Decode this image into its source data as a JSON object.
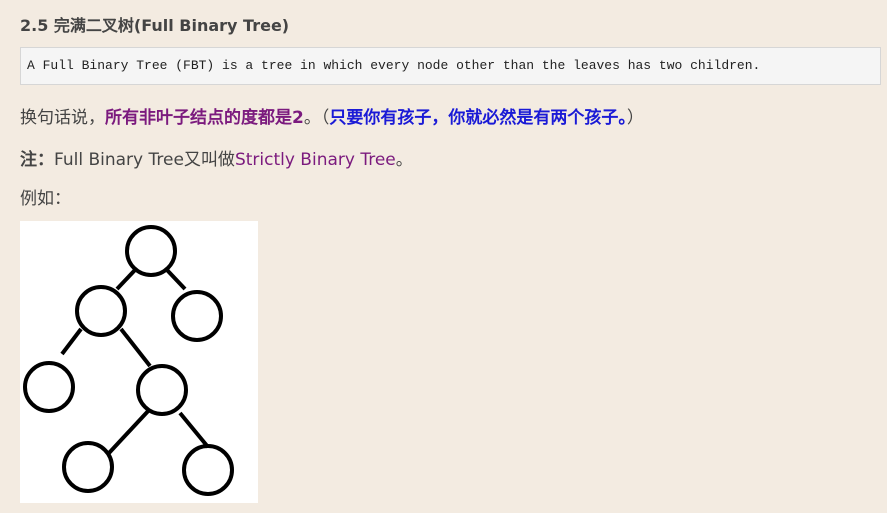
{
  "section": {
    "title": "2.5 完满二叉树(Full Binary Tree)"
  },
  "definition": {
    "code_text": "A Full Binary Tree (FBT) is a tree in which every node other than the leaves has two children."
  },
  "paragraph1": {
    "prefix": "换句话说，",
    "highlight": "所有非叶子结点的度都是2",
    "period": "。",
    "open_paren": "（",
    "note": "只要你有孩子，你就必然是有两个孩子。",
    "close_paren": "）"
  },
  "paragraph2": {
    "label": "注：",
    "text": "Full Binary Tree又叫做",
    "alias": "Strictly Binary Tree",
    "period": "。"
  },
  "paragraph3": {
    "text": "例如："
  },
  "figure": {
    "type": "full-binary-tree-diagram",
    "node_count": 7
  }
}
